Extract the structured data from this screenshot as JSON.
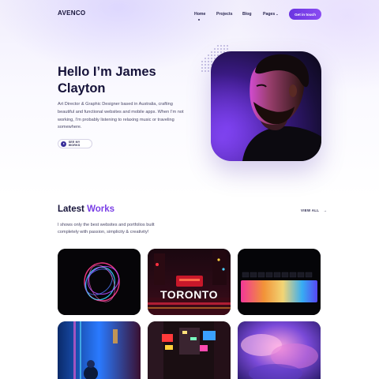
{
  "nav": {
    "logo": "AVENCO",
    "links": [
      {
        "label": "Home"
      },
      {
        "label": "Projects"
      },
      {
        "label": "Blog"
      },
      {
        "label": "Pages"
      }
    ],
    "pages_caret": "⌄",
    "cta_label": "Get in touch"
  },
  "hero": {
    "title": "Hello I’m James Clayton",
    "description": "Art Director & Graphic Designer based in Australia, crafting beautiful and functional websites and mobile apps. When I’m not working, I’m probably listening to relaxing music or traveling somewhere.",
    "see_button_label": "SEE MY WORKS"
  },
  "works": {
    "title_plain": "Latest",
    "title_accent": "Works",
    "view_all_label": "VIEW ALL",
    "view_all_arrow": "→",
    "description": "I shows only the best websites and portfolios built completely with passion, simplicity & creativity!",
    "tile_sign_text": "TORONTO"
  },
  "colors": {
    "accent": "#7a3fe6",
    "cta_gradient_start": "#6a34e0",
    "cta_gradient_end": "#8a4cf2",
    "heading": "#16133a"
  }
}
